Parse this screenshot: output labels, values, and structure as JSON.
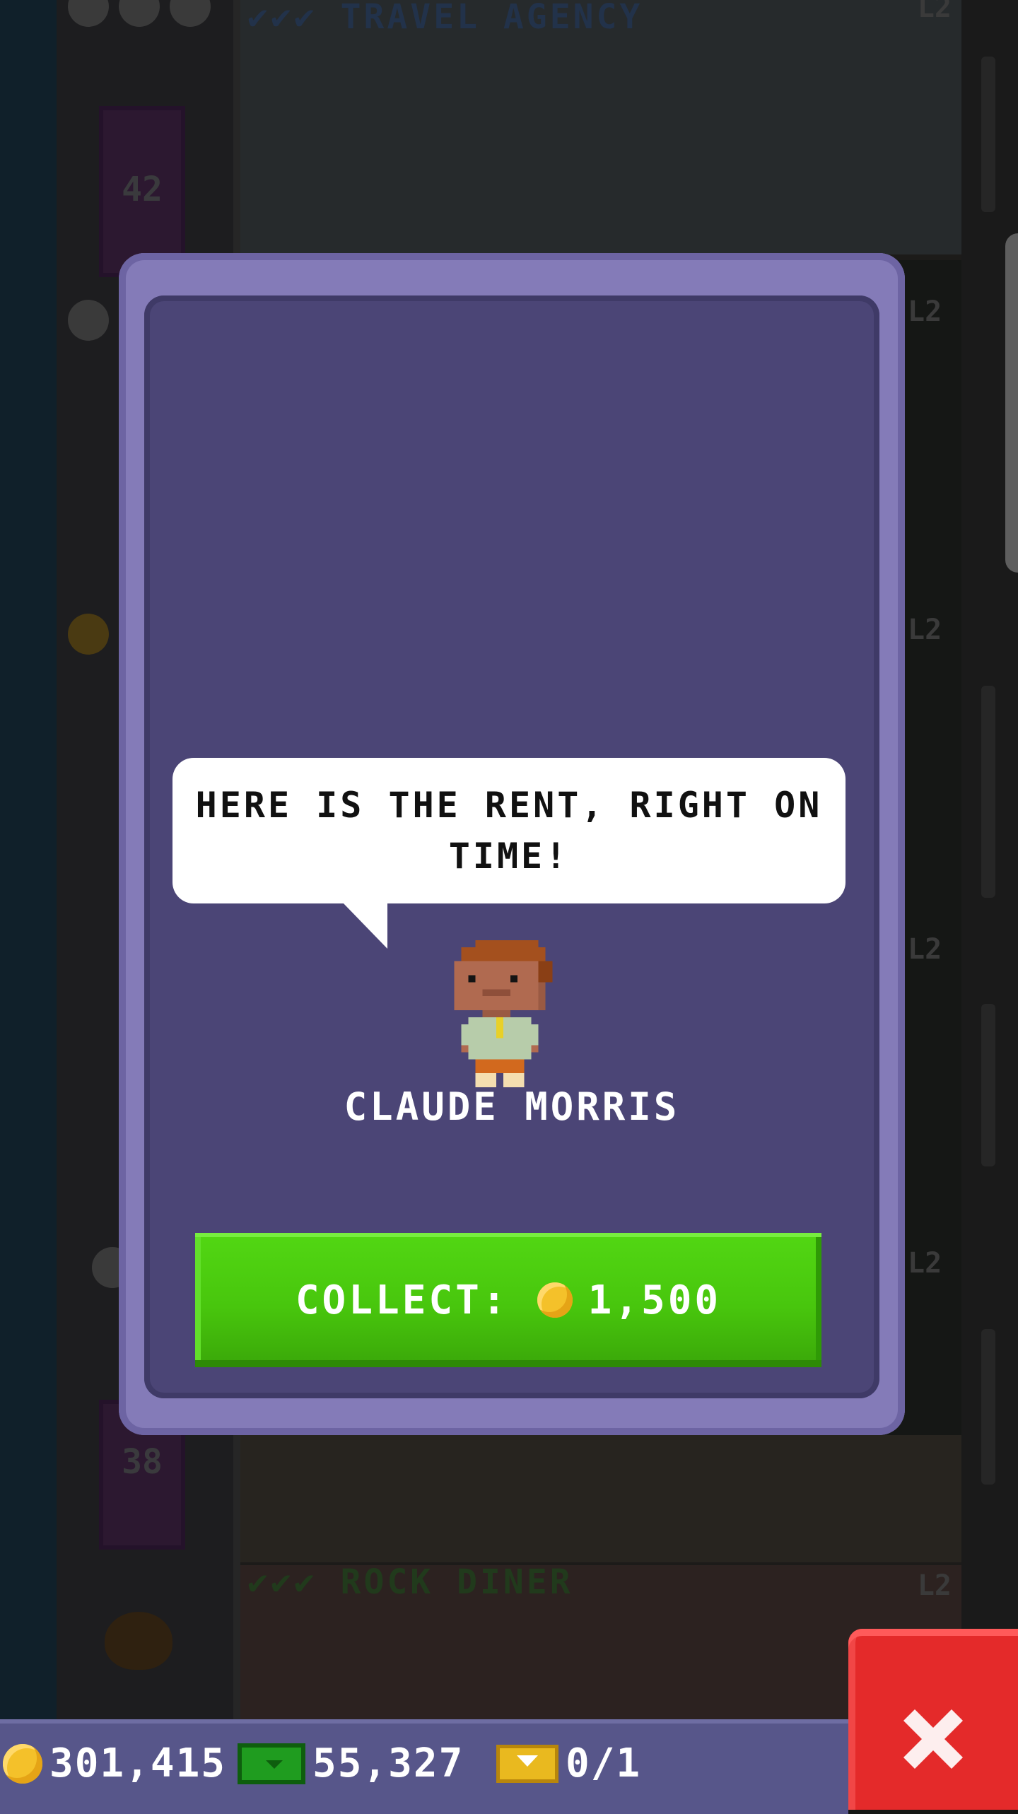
{
  "background": {
    "floors": [
      {
        "label": "TRAVEL AGENCY",
        "level": "L2",
        "checks": "✔✔✔",
        "color": "#22324a"
      },
      {
        "label": "ROCK DINER",
        "level": "L2",
        "checks": "✔✔✔",
        "color": "#213a1c"
      }
    ],
    "floor_numbers": [
      "42",
      "38"
    ],
    "side_levels": [
      "L2",
      "L2",
      "L2",
      "L2"
    ]
  },
  "modal": {
    "speech": "HERE IS THE RENT, RIGHT ON TIME!",
    "tenant_name": "CLAUDE MORRIS",
    "collect_label": "COLLECT:",
    "collect_amount": "1,500"
  },
  "status_bar": {
    "coins": "301,415",
    "bux": "55,327",
    "tickets": "0/1"
  },
  "colors": {
    "modal_frame": "#847bb8",
    "modal_inner": "#4b4576",
    "collect_green": "#48c60d",
    "close_red": "#e42a2a",
    "status_bar": "#57568a",
    "coin_gold": "#f4c12a"
  },
  "icons": {
    "coin": "coin-icon",
    "bux": "bux-icon",
    "ticket": "golden-ticket-icon",
    "close": "close-icon"
  }
}
